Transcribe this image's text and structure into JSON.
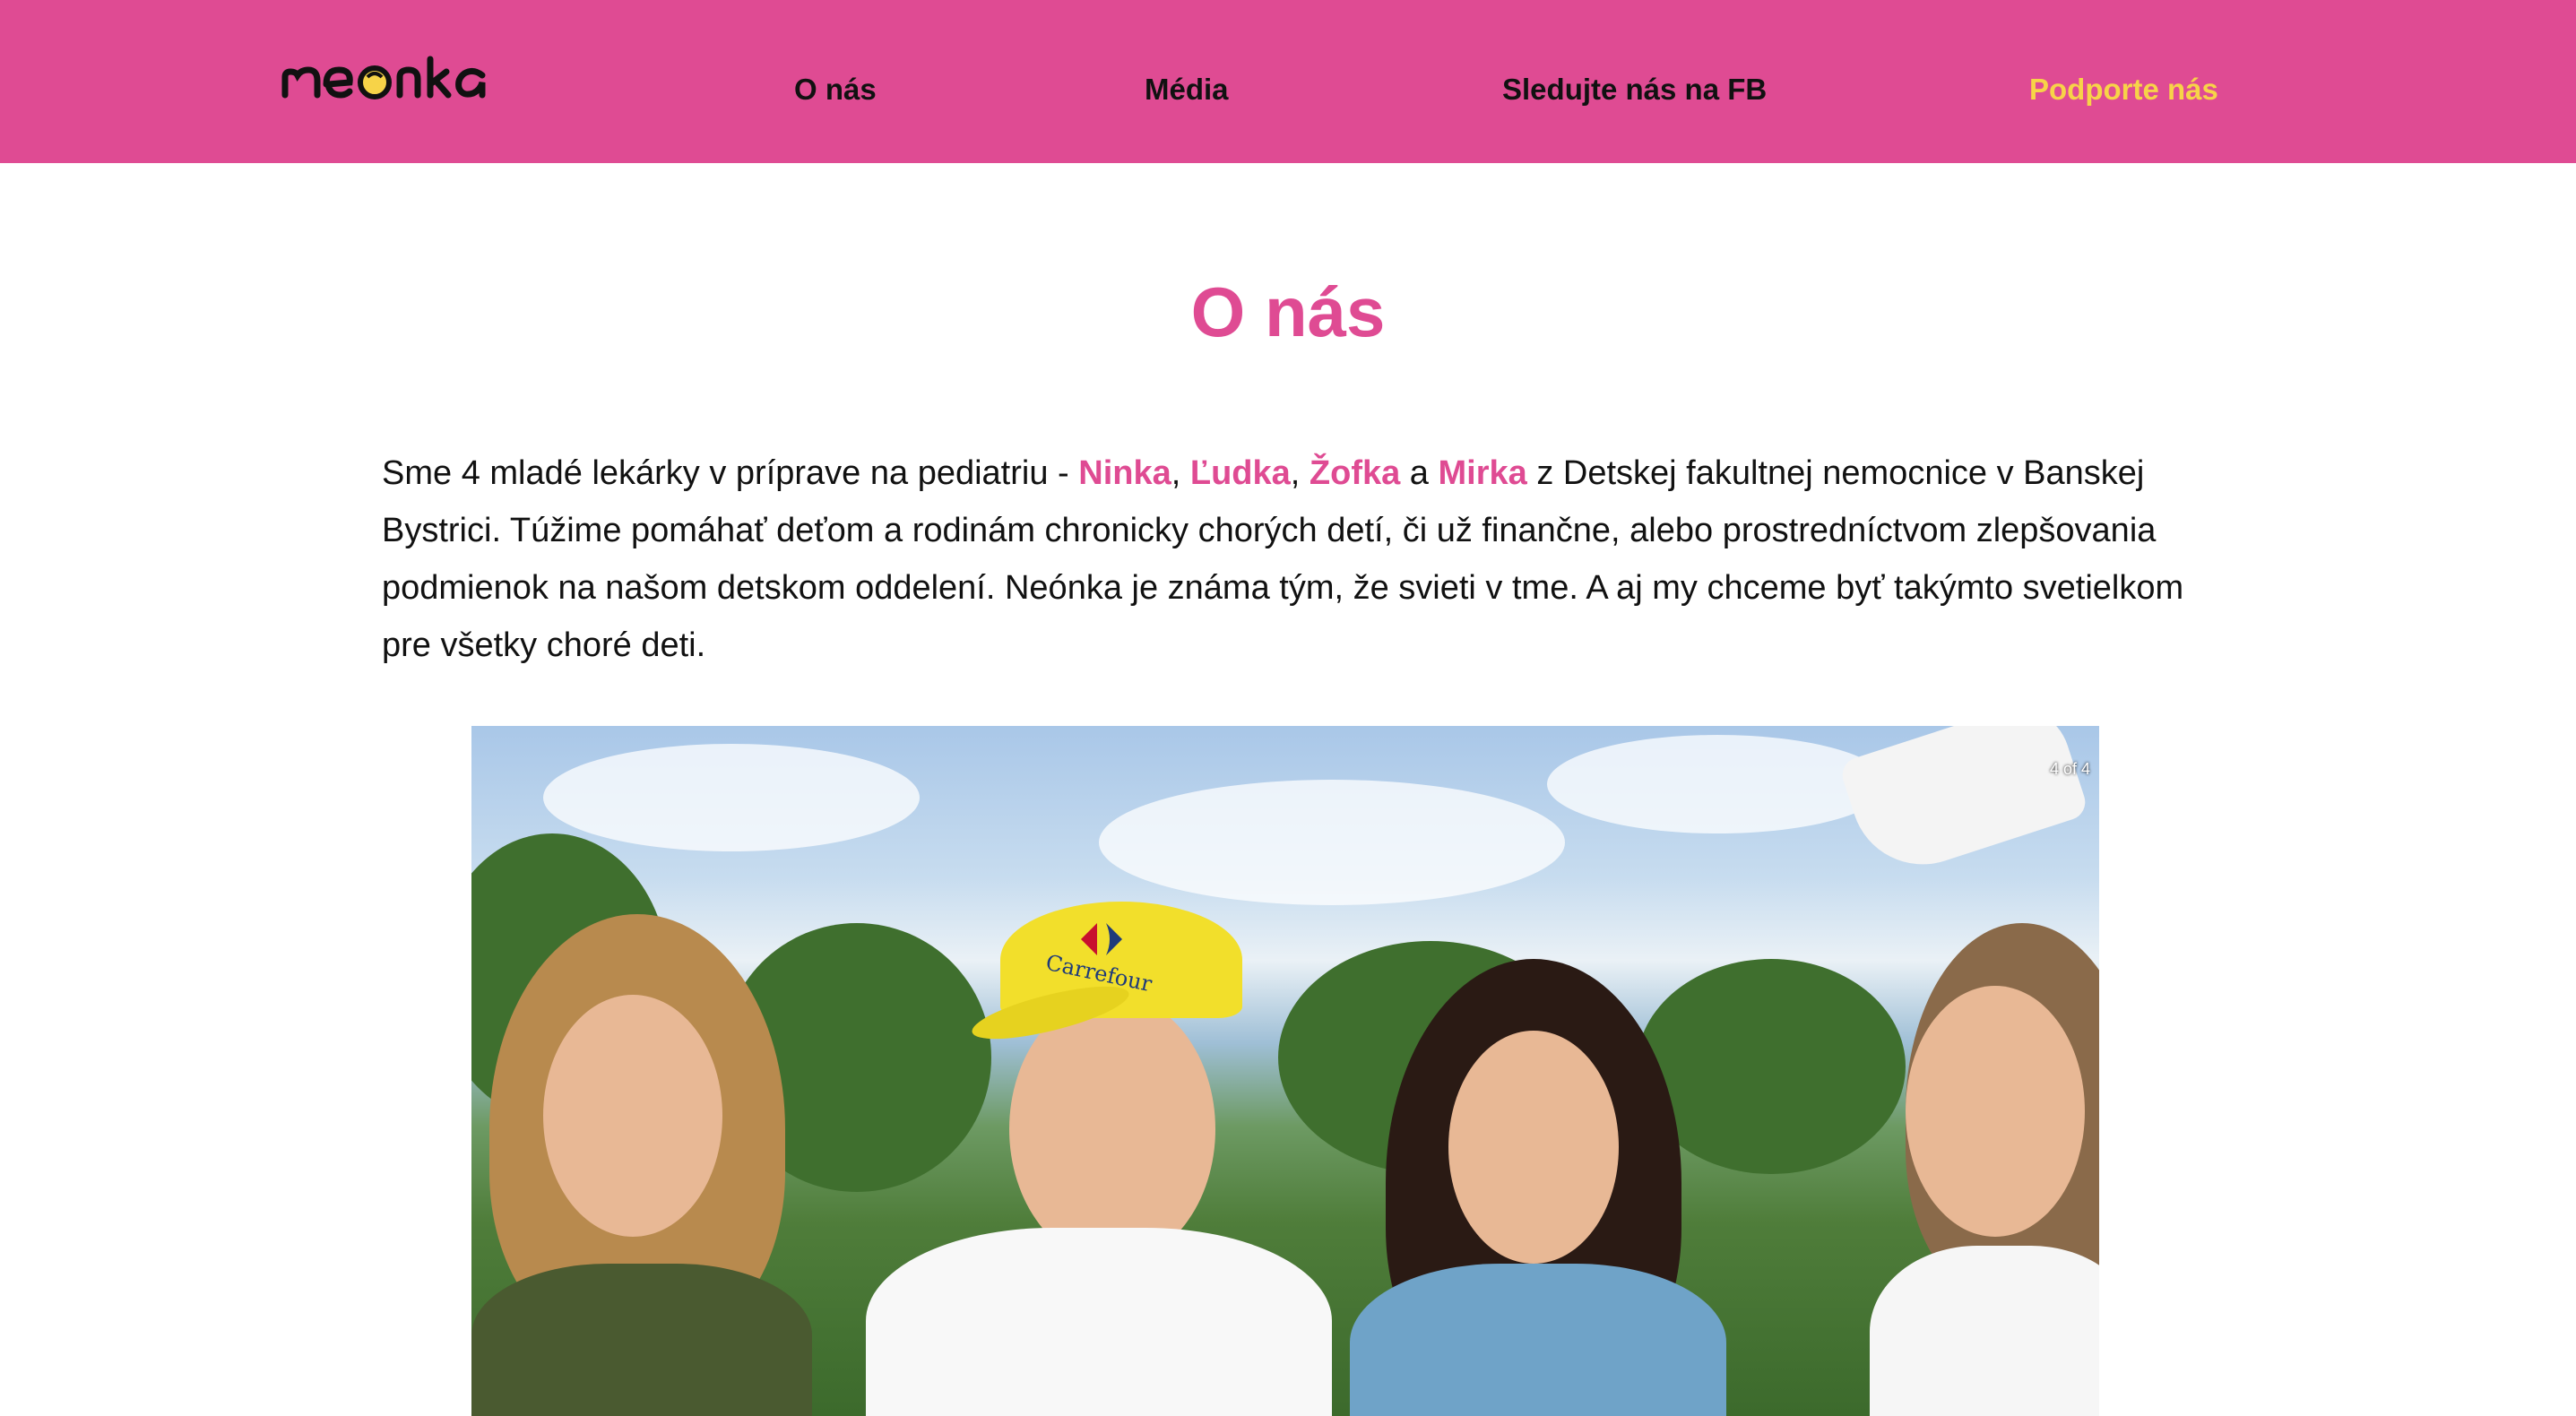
{
  "header": {
    "logo_text": "neonka",
    "nav": [
      {
        "label": "O nás"
      },
      {
        "label": "Média"
      },
      {
        "label": "Sledujte nás na FB"
      },
      {
        "label": "Podporte nás"
      }
    ]
  },
  "main": {
    "title": "O nás",
    "intro": {
      "part1": "Sme 4 mladé lekárky v príprave na pediatriu - ",
      "names": [
        "Ninka",
        "Ľudka",
        "Žofka",
        "Mirka"
      ],
      "sep1": ", ",
      "sep2": ", ",
      "sep3": " a ",
      "part2": " z Detskej fakultnej nemocnice v Banskej Bystrici. Túžime pomáhať deťom a rodinám chronicky chorých detí, či už finančne, alebo prostredníctvom zlepšovania podmienok na našom detskom oddelení. Neónka je známa tým, že svieti v tme. A aj my chceme byť takýmto svetielkom pre všetky choré deti."
    },
    "slideshow": {
      "counter": "4 of 4",
      "cap_text": "Carrefour"
    }
  },
  "colors": {
    "brand_pink": "#df4b93",
    "support_yellow": "#f7d348",
    "text": "#111111"
  }
}
